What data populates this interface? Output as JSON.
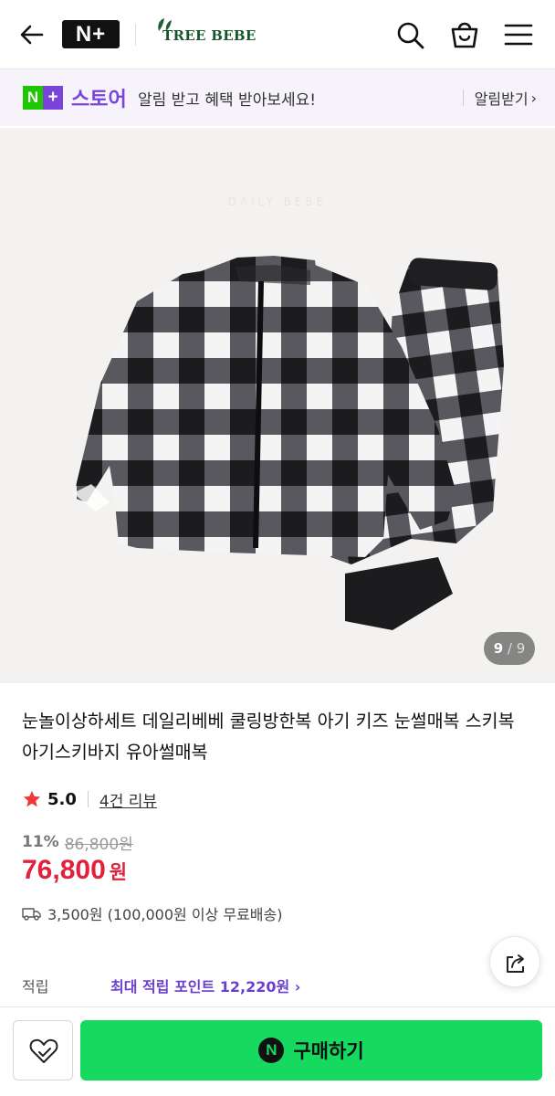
{
  "header": {
    "logo_text": "N+",
    "brand_name": "TREE BEBE"
  },
  "store_banner": {
    "logo_n": "N",
    "logo_plus": "+",
    "store_word": "스토어",
    "message": "알림 받고 혜택 받아보세요!",
    "link_label": "알림받기",
    "link_chevron": "›"
  },
  "product_image": {
    "watermark": "DAILY BEBE",
    "current": "9",
    "separator": "/",
    "total": "9"
  },
  "product": {
    "title": "눈놀이상하세트 데일리베베 쿨링방한복 아기 키즈 눈썰매복 스키복 아기스키바지 유아썰매복",
    "rating": "5.0",
    "review_count": "4건 리뷰",
    "discount": "11%",
    "original_price": "86,800원",
    "price": "76,800",
    "price_unit": "원",
    "shipping": "3,500원 (100,000원 이상 무료배송)"
  },
  "points": {
    "label": "적립",
    "link": "최대 적립 포인트 12,220원 ›"
  },
  "bottom_bar": {
    "buy_n": "N",
    "buy_label": "구매하기"
  },
  "colors": {
    "naver_green": "#1ec800",
    "store_purple": "#7a43d9",
    "price_red": "#e0223c",
    "buy_green": "#16d95f"
  },
  "icons": [
    "back-arrow-icon",
    "search-icon",
    "shopping-bag-icon",
    "hamburger-menu-icon",
    "star-icon",
    "truck-icon",
    "share-icon",
    "heart-icon"
  ]
}
